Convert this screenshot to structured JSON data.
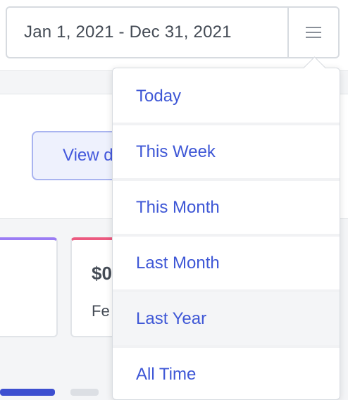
{
  "date_picker": {
    "range_label": "Jan 1, 2021 - Dec 31, 2021",
    "menu_icon": "hamburger-icon"
  },
  "background": {
    "view_button_label": "View d",
    "cards": [
      {
        "value": "",
        "label": ""
      },
      {
        "value": "$0",
        "label": "Fe"
      }
    ]
  },
  "dropdown": {
    "items": [
      {
        "label": "Today"
      },
      {
        "label": "This Week"
      },
      {
        "label": "This Month"
      },
      {
        "label": "Last Month"
      },
      {
        "label": "Last Year"
      },
      {
        "label": "All Time"
      }
    ],
    "hovered_index": 4
  },
  "colors": {
    "accent": "#3e57d6",
    "border": "#d7dbe0",
    "text": "#444b55",
    "card_a_accent": "#9b7cf4",
    "card_b_accent": "#ec5a80"
  }
}
